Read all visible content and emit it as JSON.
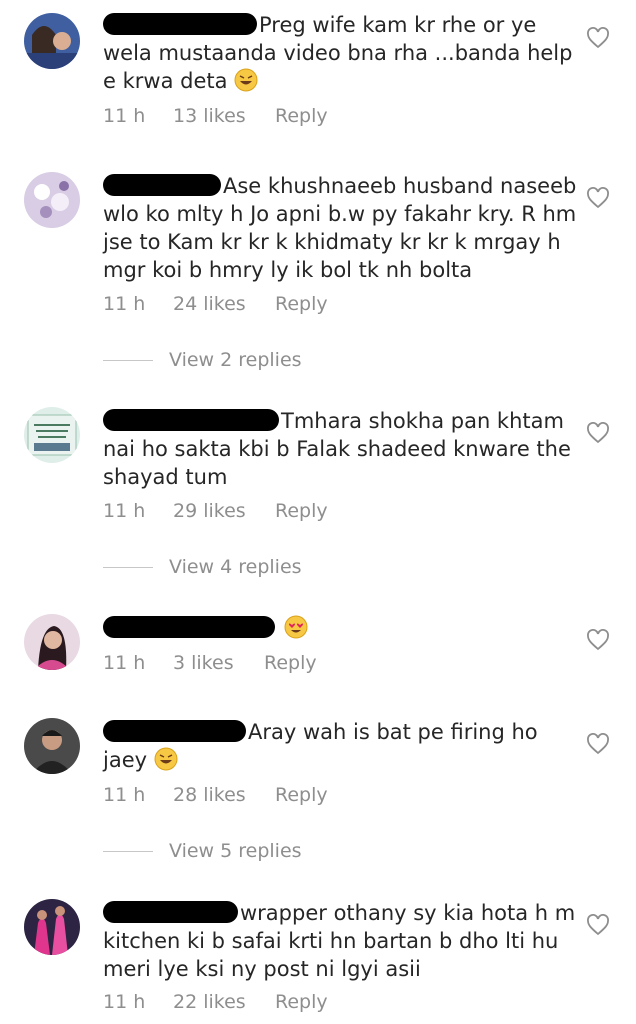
{
  "comments": [
    {
      "text": "Preg wife kam kr rhe or ye wela mustaanda video bna rha ...banda help e krwa deta",
      "emoji": "grinning-sweat-emoji",
      "time": "11 h",
      "likes": "13 likes",
      "reply": "Reply"
    },
    {
      "text": "Ase khushnaeeb husband naseeb wlo ko mlty h Jo apni b.w py fakahr kry. R hm jse to Kam kr kr k khidmaty kr kr k mrgay h mgr koi b hmry ly ik bol tk nh bolta",
      "time": "11 h",
      "likes": "24 likes",
      "reply": "Reply",
      "view_replies": "View 2 replies"
    },
    {
      "text": "Tmhara shokha pan khtam nai ho sakta kbi b Falak shadeed knware the shayad tum",
      "time": "11 h",
      "likes": "29 likes",
      "reply": "Reply",
      "view_replies": "View 4 replies"
    },
    {
      "text": "",
      "emoji": "heart-eyes-emoji",
      "time": "11 h",
      "likes": "3 likes",
      "reply": "Reply"
    },
    {
      "text": "Aray wah is bat pe firing ho jaey",
      "emoji": "grinning-sweat-emoji",
      "time": "11 h",
      "likes": "28 likes",
      "reply": "Reply",
      "view_replies": "View 5 replies"
    },
    {
      "text": "wrapper othany sy kia hota h m kitchen ki b safai krti hn bartan b dho lti hu meri lye ksi ny post ni lgyi asii",
      "time": "11 h",
      "likes": "22 likes",
      "reply": "Reply"
    }
  ],
  "colors": {
    "meta": "#8e8e8e",
    "text": "#262626",
    "redaction": "#000000"
  }
}
